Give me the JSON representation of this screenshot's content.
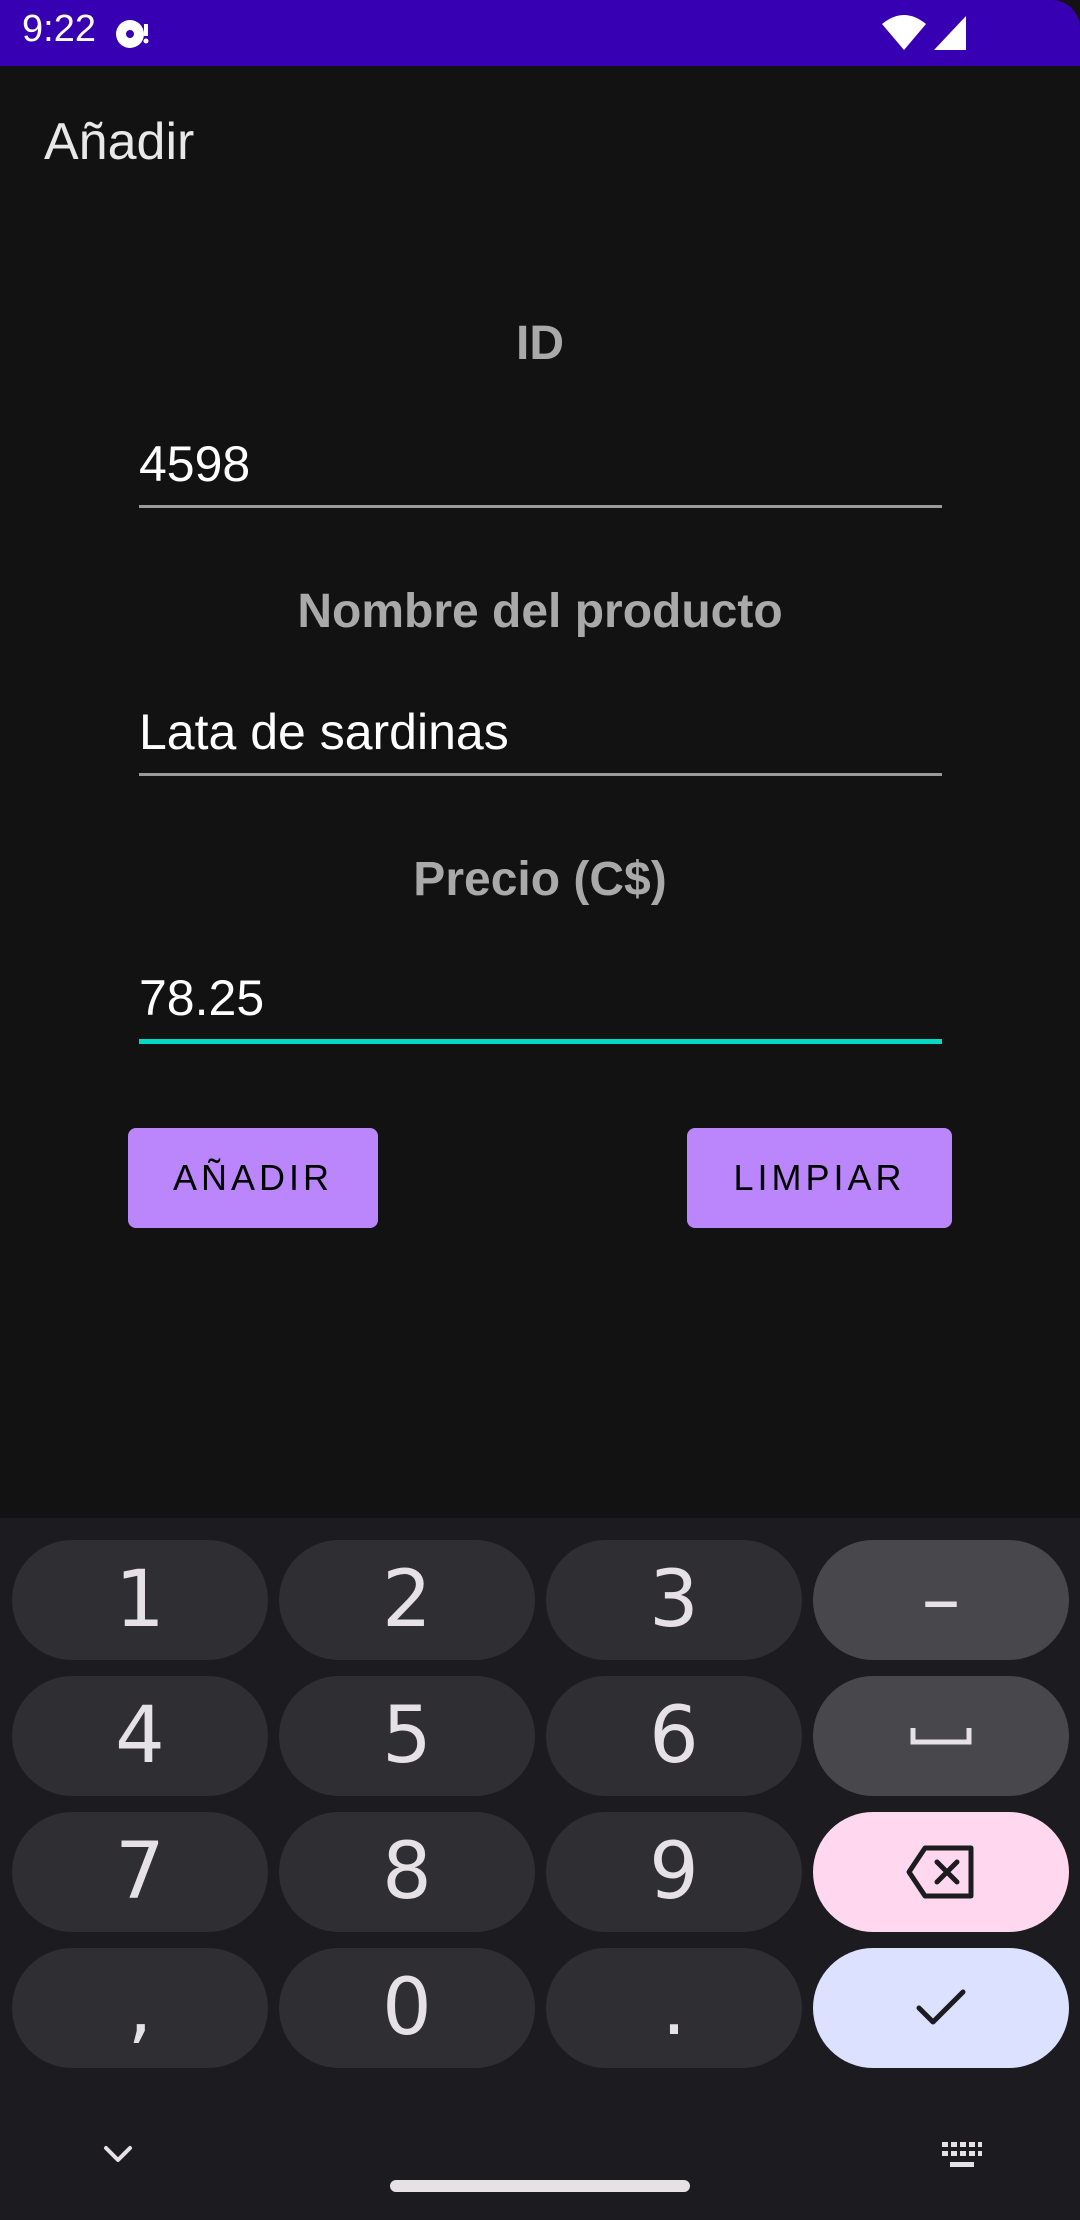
{
  "status_bar": {
    "time": "9:22",
    "background": "#3700B3"
  },
  "app_bar": {
    "title": "Añadir"
  },
  "form": {
    "id": {
      "label": "ID",
      "value": "4598"
    },
    "name": {
      "label": "Nombre del producto",
      "value": "Lata de sardinas"
    },
    "price": {
      "label": "Precio (C$)",
      "value": "78.25"
    },
    "add_button": "AÑADIR",
    "clear_button": "LIMPIAR",
    "accent": "#03DAC5",
    "button_color": "#BB86FC"
  },
  "keyboard": {
    "keys": [
      "1",
      "2",
      "3",
      "–",
      "4",
      "5",
      "6",
      "space",
      "7",
      "8",
      "9",
      "backspace",
      ",",
      "0",
      ".",
      "enter"
    ],
    "labels": {
      "k1": "1",
      "k2": "2",
      "k3": "3",
      "dash": "–",
      "k4": "4",
      "k5": "5",
      "k6": "6",
      "k7": "7",
      "k8": "8",
      "k9": "9",
      "comma": ",",
      "k0": "0",
      "dot": "."
    },
    "icons": [
      "space-bar-icon",
      "backspace-icon",
      "checkmark-icon",
      "chevron-down-icon",
      "keyboard-icon"
    ]
  }
}
